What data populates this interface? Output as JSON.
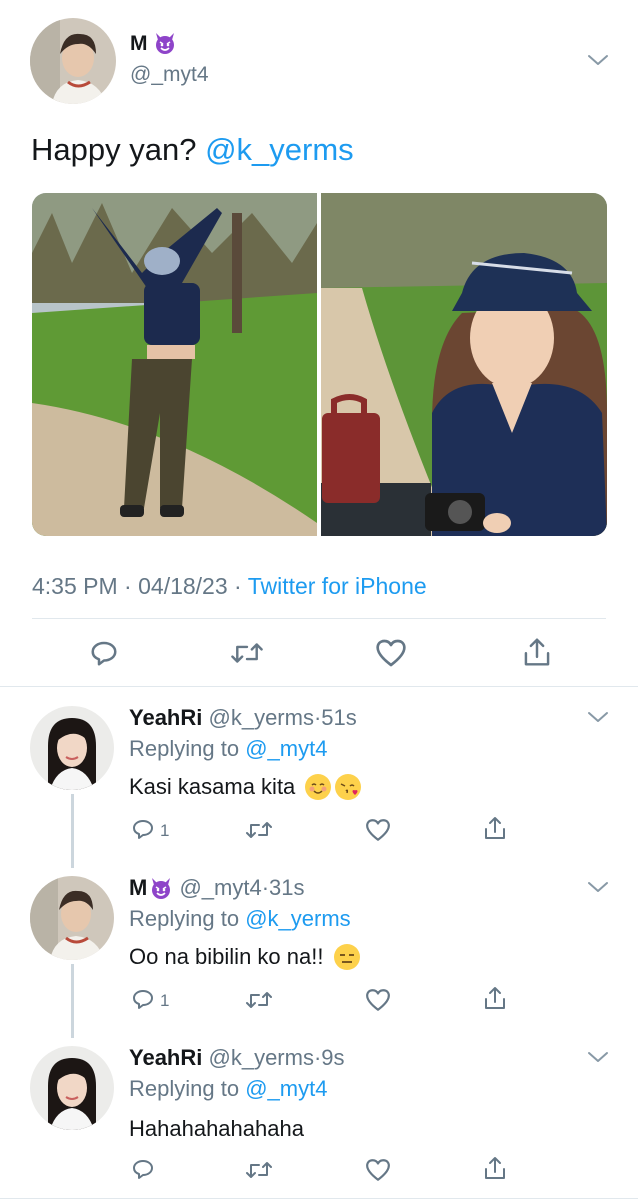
{
  "tweet": {
    "author_name": "M",
    "author_handle": "@_myt4",
    "text": "Happy yan? ",
    "mention": "@k_yerms",
    "time": "4:35 PM",
    "date": "04/18/23",
    "source": "Twitter for iPhone",
    "separator": "·"
  },
  "replies": [
    {
      "name": "YeahRi",
      "handle": "@k_yerms",
      "time": "51s",
      "replying_prefix": "Replying to ",
      "replying_to": "@_myt4",
      "text": "Kasi kasama kita",
      "reply_count": "1"
    },
    {
      "name": "M",
      "handle": "@_myt4",
      "time": "31s",
      "replying_prefix": "Replying to ",
      "replying_to": "@k_yerms",
      "text": "Oo na bibilin ko na!!",
      "reply_count": "1"
    },
    {
      "name": "YeahRi",
      "handle": "@k_yerms",
      "time": "9s",
      "replying_prefix": "Replying to ",
      "replying_to": "@_myt4",
      "text": "Hahahahahahaha",
      "reply_count": ""
    }
  ],
  "colors": {
    "link": "#1d9bf0",
    "muted": "#657786",
    "divider": "#e1e8ed",
    "devil_emoji": "#8e44c9"
  },
  "icons": [
    "chevron-down-icon",
    "reply-icon",
    "retweet-icon",
    "like-icon",
    "share-icon",
    "devil-emoji",
    "blush-emoji",
    "kiss-emoji",
    "expressionless-emoji"
  ]
}
